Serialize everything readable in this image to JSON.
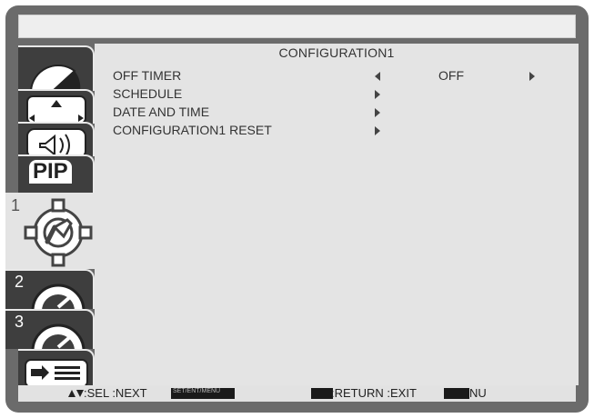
{
  "menu": {
    "title": "CONFIGURATION1",
    "items": [
      {
        "label": "OFF TIMER",
        "value": "OFF"
      },
      {
        "label": "SCHEDULE"
      },
      {
        "label": "DATE AND TIME"
      },
      {
        "label": "CONFIGURATION1 RESET"
      }
    ]
  },
  "tabs": [
    {
      "icon": "picture-icon"
    },
    {
      "icon": "screen-icon"
    },
    {
      "icon": "audio-icon"
    },
    {
      "icon": "pip-icon",
      "label": "PIP"
    },
    {
      "icon": "configuration-icon",
      "number": "1",
      "active": true
    },
    {
      "icon": "gauge-icon",
      "number": "2"
    },
    {
      "icon": "gauge-icon",
      "number": "3"
    },
    {
      "icon": "source-list-icon"
    }
  ],
  "footer": {
    "sel_next": ":SEL :NEXT",
    "set_label": "SET/ENT/MENU",
    "return_exit": ":RETURN :EXIT",
    "nu": "NU"
  },
  "colors": {
    "frame": "#6b6b6b",
    "panel": "#e4e4e4",
    "tab": "#3e3e3e"
  }
}
